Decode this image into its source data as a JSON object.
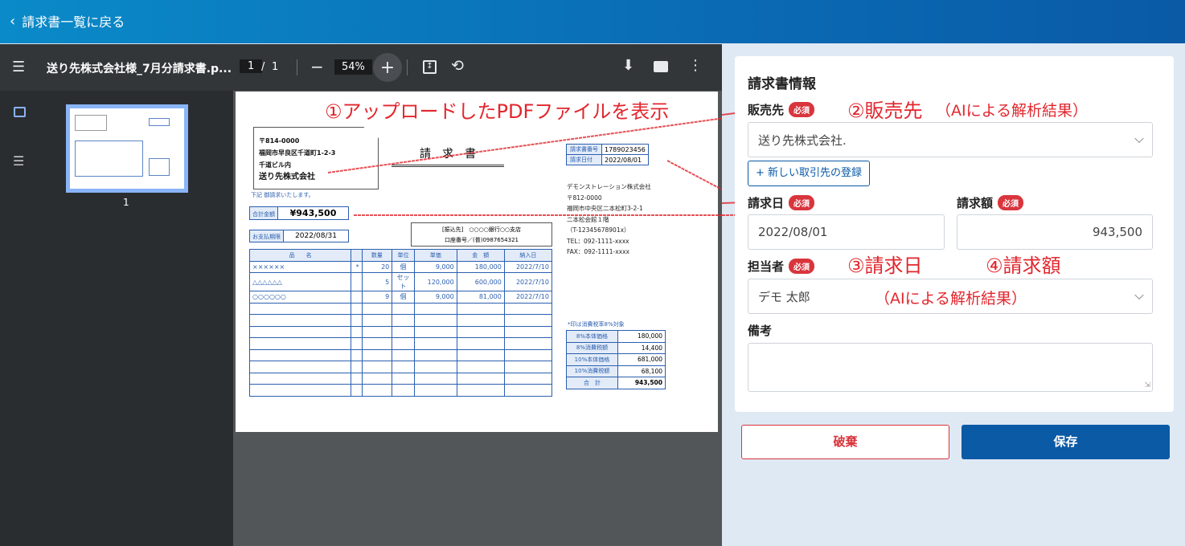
{
  "topbar": {
    "back_label": "請求書一覧に戻る"
  },
  "viewer": {
    "filename": "送り先株式会社様_7月分請求書.p...",
    "page_current": "1",
    "page_sep": "/",
    "page_total": "1",
    "zoom": "54%",
    "thumb_page": "1"
  },
  "pdf": {
    "addr": {
      "zip": "〒814-0000",
      "line1": "福岡市早良区千道町1-2-3",
      "line2": "千道ビル内",
      "name": "送り先株式会社"
    },
    "title": "請　求　書",
    "note_request": "下記 御請求いたします。",
    "total_label": "合計金額",
    "total_value": "¥943,500",
    "due_label": "お支払期限",
    "due_value": "2022/08/31",
    "bank_label": "[振込先]　○○○○銀行○○支店",
    "bank_account": "口座番号／(普)0987654321",
    "inv_no_label": "請求書番号",
    "inv_no": "1789023456",
    "inv_date_label": "請求日付",
    "inv_date": "2022/08/01",
    "issuer": {
      "name": "デモンストレーション株式会社",
      "zip": "〒812-0000",
      "addr": "福岡市中央区二本松町3-2-1",
      "bldg": "二本松会館１階",
      "reg": "（T-12345678901x）",
      "tel": "TEL：092-1111-xxxx",
      "fax": "FAX：092-1111-xxxx"
    },
    "table_headers": [
      "品　　名",
      "",
      "数量",
      "単位",
      "単価",
      "金　額",
      "納入日"
    ],
    "rows": [
      [
        "××××××",
        "*",
        "20",
        "個",
        "9,000",
        "180,000",
        "2022/7/10"
      ],
      [
        "△△△△△△",
        "",
        "5",
        "セット",
        "120,000",
        "600,000",
        "2022/7/10"
      ],
      [
        "○○○○○○",
        "",
        "9",
        "個",
        "9,000",
        "81,000",
        "2022/7/10"
      ]
    ],
    "tax_note": "*印は消費税率8%対象",
    "tax_rows": [
      [
        "8%本体価格",
        "180,000"
      ],
      [
        "8%消費税額",
        "14,400"
      ],
      [
        "10%本体価格",
        "681,000"
      ],
      [
        "10%消費税額",
        "68,100"
      ],
      [
        "合　計",
        "943,500"
      ]
    ]
  },
  "annotations": {
    "a1": "①アップロードしたPDFファイルを表示",
    "a2": "②販売先",
    "a2_sub": "（AIによる解析結果）",
    "a3": "③請求日",
    "a4": "④請求額",
    "a34_sub": "（AIによる解析結果）"
  },
  "form": {
    "title": "請求書情報",
    "required": "必須",
    "seller_label": "販売先",
    "seller_value": "送り先株式会社.",
    "new_partner_button": "+ 新しい取引先の登録",
    "date_label": "請求日",
    "date_value": "2022/08/01",
    "amount_label": "請求額",
    "amount_value": "943,500",
    "person_label": "担当者",
    "person_value": "デモ 太郎",
    "remarks_label": "備考",
    "remarks_value": "",
    "discard_button": "破棄",
    "save_button": "保存"
  },
  "colors": {
    "accent": "#0a5aa6",
    "required": "#d9353d",
    "annotation": "#e2262d"
  }
}
